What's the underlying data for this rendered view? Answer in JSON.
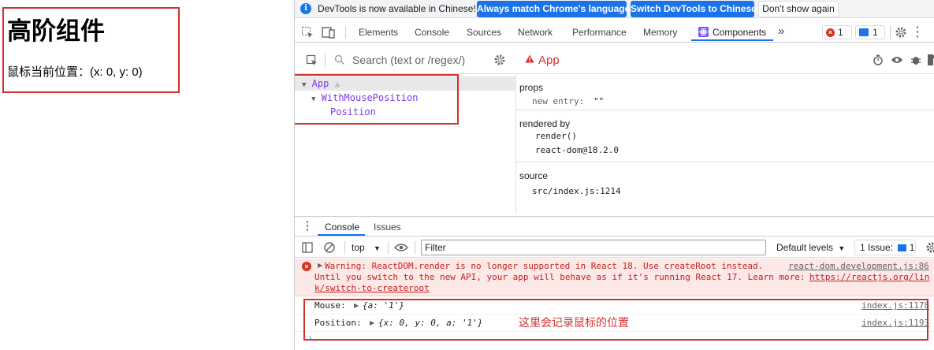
{
  "page": {
    "heading": "高阶组件",
    "mouse_line": "鼠标当前位置：(x: 0, y: 0)"
  },
  "infobar": {
    "message": "DevTools is now available in Chinese!",
    "btn_match": "Always match Chrome's language",
    "btn_switch": "Switch DevTools to Chinese",
    "btn_dismiss": "Don't show again"
  },
  "tabs": {
    "elements": "Elements",
    "console": "Console",
    "sources": "Sources",
    "network": "Network",
    "performance": "Performance",
    "memory": "Memory",
    "components": "Components",
    "more": "»",
    "error_count": "1",
    "message_count": "1"
  },
  "components": {
    "search_placeholder": "Search (text or /regex/)",
    "tree": [
      {
        "label": "App"
      },
      {
        "label": "WithMousePosition"
      },
      {
        "label": "Position"
      }
    ],
    "selected": "App",
    "props_label": "props",
    "props_key": "new entry:",
    "props_value": "\"\"",
    "rendered_by_label": "rendered by",
    "rendered_by": [
      "render()",
      "react-dom@18.2.0"
    ],
    "source_label": "source",
    "source_value": "src/index.js:1214"
  },
  "drawer": {
    "tab_console": "Console",
    "tab_issues": "Issues",
    "context": "top",
    "filter_placeholder": "Filter",
    "levels": "Default levels",
    "issues_label": "1 Issue:",
    "issues_count": "1"
  },
  "console": {
    "warning_line1": "Warning: ReactDOM.render is no longer supported in React 18. Use createRoot instead.",
    "warning_line2": "Until you switch to the new API, your app will behave as if it's running React 17. Learn more:",
    "warning_link": "https://reactjs.org/lin",
    "warning_line3": "k/switch-to-createroot",
    "warning_source": "react-dom.development.js:86",
    "logs": [
      {
        "label": "Mouse:",
        "value": "{a: '1'}",
        "source": "index.js:1178"
      },
      {
        "label": "Position:",
        "value": "{x: 0, y: 0, a: '1'}",
        "source": "index.js:1193"
      }
    ],
    "annotation": "这里会记录鼠标的位置"
  },
  "colors": {
    "accent": "#1a73e8",
    "error": "#d93025",
    "annotation_red": "#d32f2f",
    "component_purple": "#7c3aed"
  }
}
